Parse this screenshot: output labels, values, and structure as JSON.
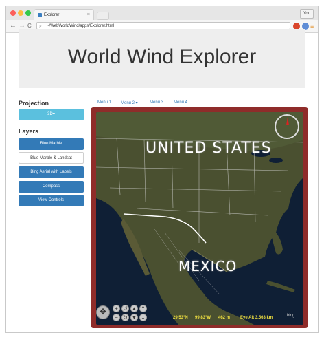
{
  "browser": {
    "tab_title": "Explorer",
    "tab_close": "×",
    "profile_label": "You",
    "url": "~/WebWorldWind/apps/Explorer.html",
    "back_glyph": "←",
    "forward_glyph": "→",
    "reload_glyph": "C"
  },
  "header": {
    "title": "World Wind Explorer"
  },
  "sidebar": {
    "projection_label": "Projection",
    "projection_button": "3D",
    "projection_caret": "▾",
    "layers_label": "Layers",
    "layers": [
      {
        "label": "Blue Marble",
        "active": false
      },
      {
        "label": "Blue Marble & Landsat",
        "active": true
      },
      {
        "label": "Bing Aerial with Labels",
        "active": false
      },
      {
        "label": "Compass",
        "active": false
      },
      {
        "label": "View Controls",
        "active": false
      }
    ]
  },
  "menu": {
    "items": [
      {
        "label": "Menu 1"
      },
      {
        "label": "Menu 2 ▾"
      },
      {
        "label": "Menu 3"
      },
      {
        "label": "Menu 4"
      }
    ]
  },
  "globe": {
    "labels": {
      "usa": "UNITED STATES",
      "mexico": "MEXICO"
    },
    "status": {
      "lat": "29.53°N",
      "lon": "99.83°W",
      "elevation": "462 m",
      "eye_alt": "Eye Alt  3,563 km"
    },
    "watermark": "bing",
    "colors": {
      "ocean": "#0f1f35",
      "land": "#4a5030",
      "frame": "#8f2c2a",
      "status_text": "#f0e040"
    }
  }
}
